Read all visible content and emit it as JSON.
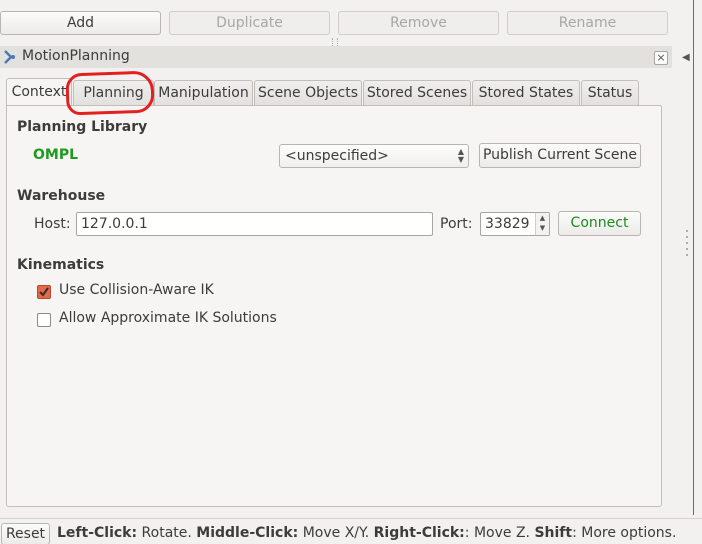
{
  "toolbar": {
    "add": "Add",
    "duplicate": "Duplicate",
    "remove": "Remove",
    "rename": "Rename"
  },
  "dock": {
    "title": "MotionPlanning",
    "close_glyph": "×"
  },
  "tabs": [
    {
      "label": "Context",
      "active": true
    },
    {
      "label": "Planning",
      "active": false
    },
    {
      "label": "Manipulation",
      "active": false
    },
    {
      "label": "Scene Objects",
      "active": false
    },
    {
      "label": "Stored Scenes",
      "active": false
    },
    {
      "label": "Stored States",
      "active": false
    },
    {
      "label": "Status",
      "active": false
    }
  ],
  "planning_library": {
    "title": "Planning Library",
    "library_name": "OMPL",
    "planner_select": "<unspecified>",
    "publish_button": "Publish Current Scene"
  },
  "warehouse": {
    "title": "Warehouse",
    "host_label": "Host:",
    "host_value": "127.0.0.1",
    "port_label": "Port:",
    "port_value": "33829",
    "connect_button": "Connect"
  },
  "kinematics": {
    "title": "Kinematics",
    "collision_aware": {
      "label": "Use Collision-Aware IK",
      "checked": true
    },
    "approx_ik": {
      "label": "Allow Approximate IK Solutions",
      "checked": false
    }
  },
  "statusbar": {
    "reset": "Reset",
    "hint_parts": [
      {
        "text": "Left-Click:",
        "bold": true
      },
      {
        "text": " Rotate. ",
        "bold": false
      },
      {
        "text": "Middle-Click:",
        "bold": true
      },
      {
        "text": " Move X/Y. ",
        "bold": false
      },
      {
        "text": "Right-Click:",
        "bold": true
      },
      {
        "text": ": Move Z. ",
        "bold": false
      },
      {
        "text": "Shift",
        "bold": true
      },
      {
        "text": ": More options.",
        "bold": false
      }
    ]
  },
  "colors": {
    "accent_green": "#1e9b1e",
    "checkbox_on": "#e2694a",
    "highlight_ring": "#e3201f"
  }
}
